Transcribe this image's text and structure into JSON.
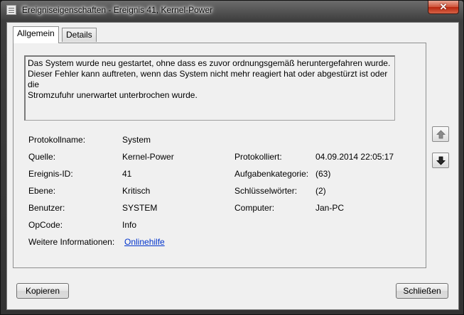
{
  "window": {
    "title": "Ereigniseigenschaften - Ereignis 41, Kernel-Power",
    "close_glyph": "✕"
  },
  "tabs": [
    {
      "label": "Allgemein"
    },
    {
      "label": "Details"
    }
  ],
  "description": {
    "line1": "Das System wurde neu gestartet, ohne dass es zuvor ordnungsgemäß heruntergefahren wurde.",
    "line2": "Dieser Fehler kann auftreten, wenn das System nicht mehr reagiert hat oder abgestürzt ist oder die",
    "line3": "Stromzufuhr unerwartet unterbrochen wurde."
  },
  "fields": {
    "protokollname": {
      "label": "Protokollname:",
      "value": "System"
    },
    "quelle": {
      "label": "Quelle:",
      "value": "Kernel-Power"
    },
    "ereignis_id": {
      "label": "Ereignis-ID:",
      "value": "41"
    },
    "ebene": {
      "label": "Ebene:",
      "value": "Kritisch"
    },
    "benutzer": {
      "label": "Benutzer:",
      "value": "SYSTEM"
    },
    "opcode": {
      "label": "OpCode:",
      "value": "Info"
    },
    "weitere_informationen": {
      "label": "Weitere Informationen:",
      "link": "Onlinehilfe"
    },
    "protokolliert": {
      "label": "Protokolliert:",
      "value": "04.09.2014 22:05:17"
    },
    "aufgabenkategorie": {
      "label": "Aufgabenkategorie:",
      "value": "(63)"
    },
    "schluesselwoerter": {
      "label": "Schlüsselwörter:",
      "value": "(2)"
    },
    "computer": {
      "label": "Computer:",
      "value": "Jan-PC"
    }
  },
  "buttons": {
    "copy": "Kopieren",
    "close": "Schließen"
  },
  "icons": {
    "up": "arrow-up-icon",
    "down": "arrow-down-icon"
  }
}
